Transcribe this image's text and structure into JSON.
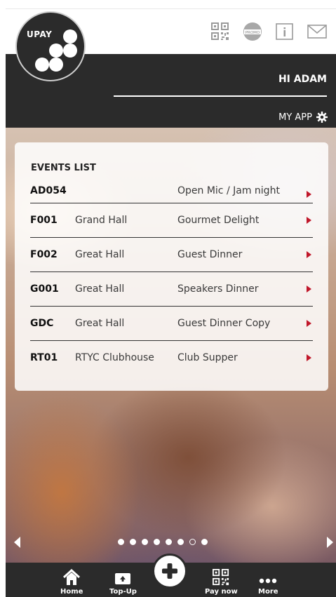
{
  "app": {
    "logo_text": "UPAY"
  },
  "header": {
    "icons": [
      "qr-code-icon",
      "promo-icon",
      "info-icon",
      "mail-icon"
    ],
    "promo_text": "PROMO",
    "greeting": "HI ADAM",
    "my_app_label": "MY APP"
  },
  "events": {
    "title": "EVENTS LIST",
    "rows": [
      {
        "code": "AD054",
        "venue": "",
        "name": "Open Mic / Jam night"
      },
      {
        "code": "F001",
        "venue": "Grand Hall",
        "name": "Gourmet Delight"
      },
      {
        "code": "F002",
        "venue": "Great Hall",
        "name": "Guest Dinner"
      },
      {
        "code": "G001",
        "venue": "Great Hall",
        "name": "Speakers Dinner"
      },
      {
        "code": "GDC",
        "venue": "Great Hall",
        "name": "Guest Dinner Copy"
      },
      {
        "code": "RT01",
        "venue": "RTYC Clubhouse",
        "name": "Club Supper"
      }
    ]
  },
  "carousel": {
    "total_pages": 8,
    "current_page": 7
  },
  "bottom_nav": {
    "home": "Home",
    "topup": "Top-Up",
    "paynow": "Pay now",
    "more": "More"
  },
  "colors": {
    "dark": "#2b2b2b",
    "accent_red": "#c0172a"
  }
}
